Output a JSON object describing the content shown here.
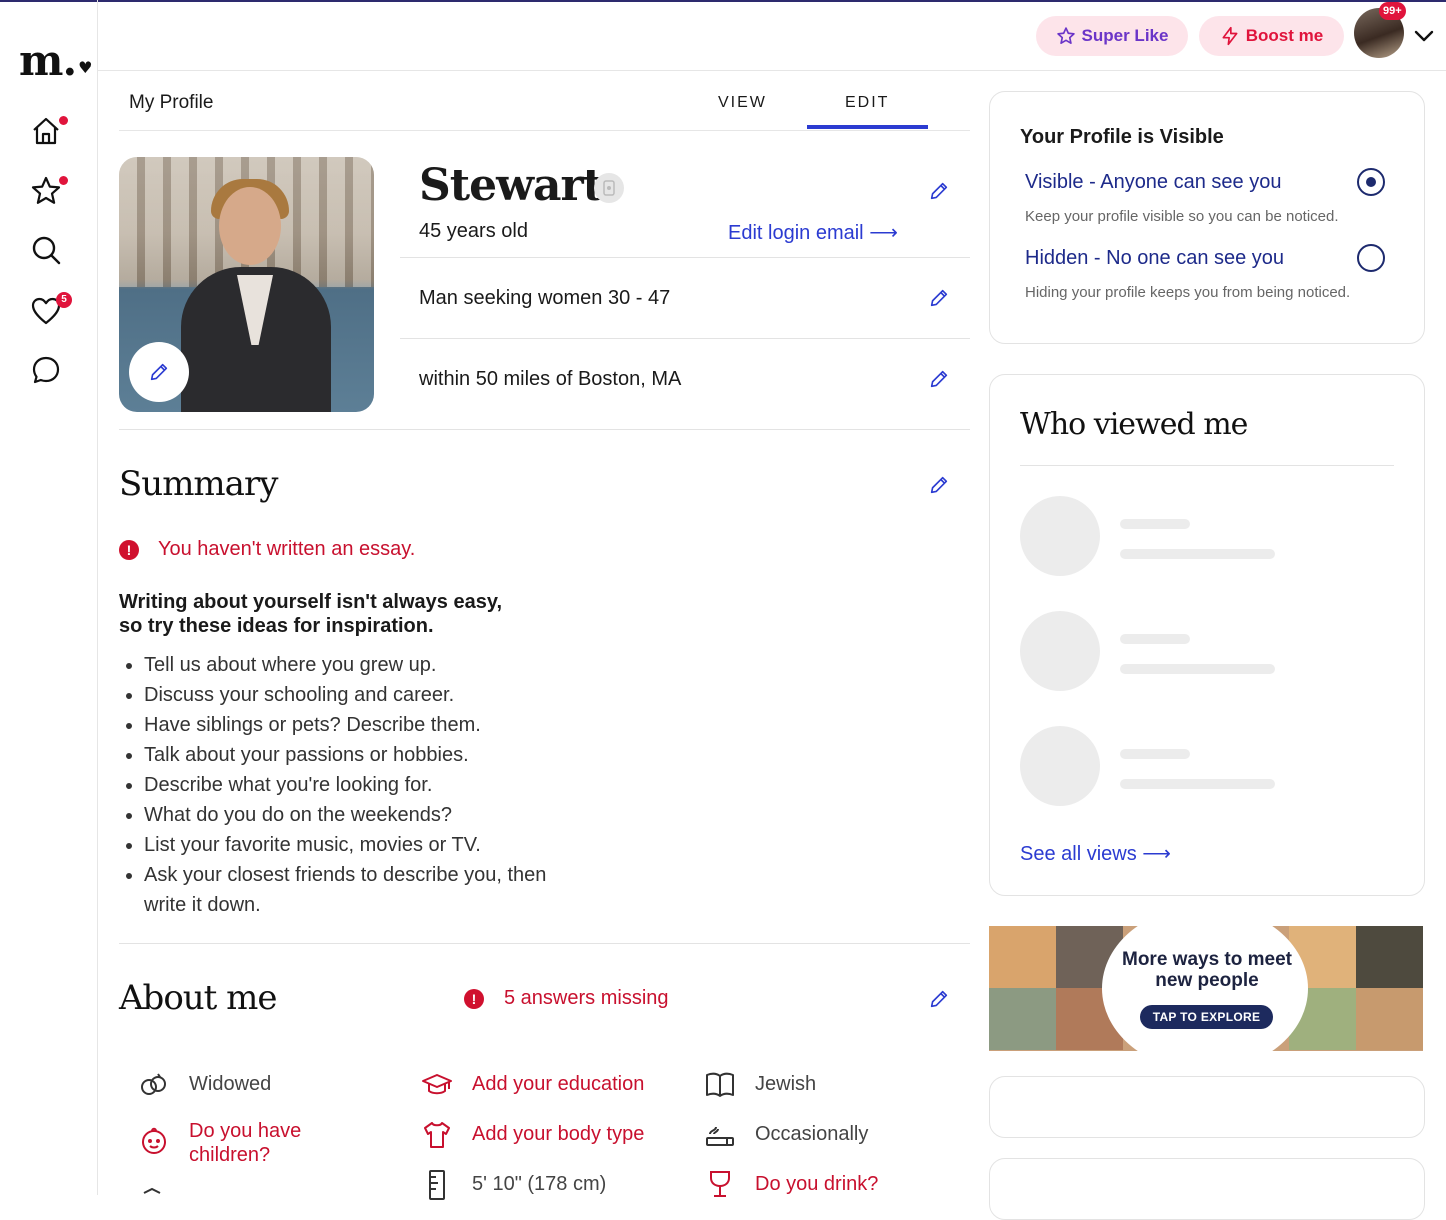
{
  "brand": {
    "logo": "m.",
    "logo_heart": "♥"
  },
  "nav": {
    "icons": [
      "home-icon",
      "star-icon",
      "search-icon",
      "heart-icon",
      "chat-icon"
    ],
    "likes_count": "5"
  },
  "header": {
    "super_like": "Super Like",
    "boost_me": "Boost me",
    "notifications": "99+"
  },
  "profile": {
    "title": "My Profile",
    "tabs": [
      "VIEW",
      "EDIT"
    ],
    "active_tab": "EDIT",
    "name": "Stewart",
    "age": "45 years old",
    "edit_login_email": "Edit login email",
    "seeking": "Man seeking women 30 - 47",
    "location": "within 50 miles of Boston, MA"
  },
  "summary": {
    "heading": "Summary",
    "alert": "You haven't written an essay.",
    "inspiration_line1": "Writing about yourself isn't always easy,",
    "inspiration_line2": "so try these ideas for inspiration.",
    "ideas": [
      "Tell us about where you grew up.",
      "Discuss your schooling and career.",
      "Have siblings or pets? Describe them.",
      "Talk about your passions or hobbies.",
      "Describe what you're looking for.",
      "What do you do on the weekends?",
      "List your favorite music, movies or TV.",
      "Ask your closest friends to describe you, then write it down."
    ]
  },
  "about": {
    "heading": "About me",
    "missing": "5 answers missing",
    "items": {
      "marital": "Widowed",
      "children": "Do you have children?",
      "education": "Add your education",
      "body_type": "Add your body type",
      "height": "5' 10\" (178 cm)",
      "religion": "Jewish",
      "smoking": "Occasionally",
      "drink": "Do you drink?"
    }
  },
  "visibility": {
    "title": "Your Profile is Visible",
    "visible_label": "Visible - Anyone can see you",
    "visible_desc": "Keep your profile visible so you can be noticed.",
    "hidden_label": "Hidden - No one can see you",
    "hidden_desc": "Hiding your profile keeps you from being noticed.",
    "selected": "visible"
  },
  "viewers": {
    "heading": "Who viewed me",
    "see_all": "See all views"
  },
  "ad": {
    "headline": "More ways to meet new people",
    "cta": "TAP TO EXPLORE"
  },
  "colors": {
    "accent": "#2b3bd1",
    "alert": "#c8102e",
    "pill_bg": "#fde4ea",
    "super_like": "#6b35c8",
    "boost": "#e0143c"
  }
}
